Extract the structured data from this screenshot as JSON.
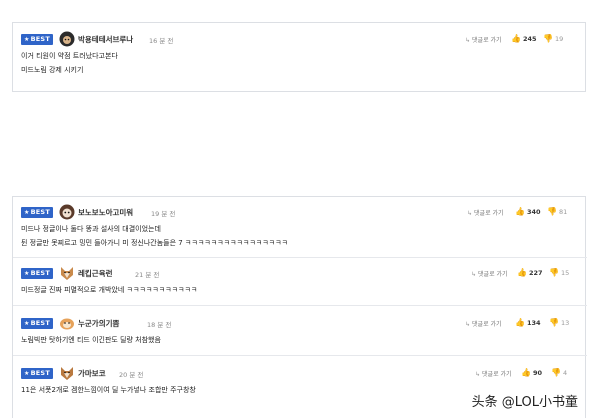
{
  "badge_label": "BEST",
  "reply_label": "댓글로 가기",
  "comments": [
    {
      "nick": "박용테테서브루나",
      "time": "16 분 전",
      "likes": "245",
      "dislikes": "19",
      "lines": [
        "이거 티원이 약점 트러났다고본다",
        "미드노림 강제 시키기"
      ]
    },
    {
      "nick": "보노보노아고미워",
      "time": "19 분 전",
      "likes": "340",
      "dislikes": "81",
      "lines": [
        "미드나 정글이나 둘다 똥과 설사의 대결이었는데",
        "뒨 정글만 못찌르고 밍민 들아가니 미 정신나간놈들은 7 ㅋㅋㅋㅋㅋㅋㅋㅋㅋㅋㅋㅋㅋㅋㅋㅋ"
      ]
    },
    {
      "nick": "레킵근육런",
      "time": "21 분 전",
      "likes": "227",
      "dislikes": "15",
      "lines": [
        "미드정글 진짜 피멸적으로 개박았네 ㅋㅋㅋㅋㅋㅋㅋㅋㅋㅋㅋ"
      ]
    },
    {
      "nick": "누군가의기쁨",
      "time": "18 분 전",
      "likes": "134",
      "dislikes": "13",
      "lines": [
        "노림빅판 탓하기엔 티드 이긴판도 딜량 처참했음"
      ]
    },
    {
      "nick": "가마보코",
      "time": "20 분 전",
      "likes": "90",
      "dislikes": "4",
      "lines": [
        "11은 서폿2개로 겜한느낌이여 딜 누가넣나 조합만 주구창창"
      ]
    }
  ],
  "watermark": "头条 @LOL小书童"
}
